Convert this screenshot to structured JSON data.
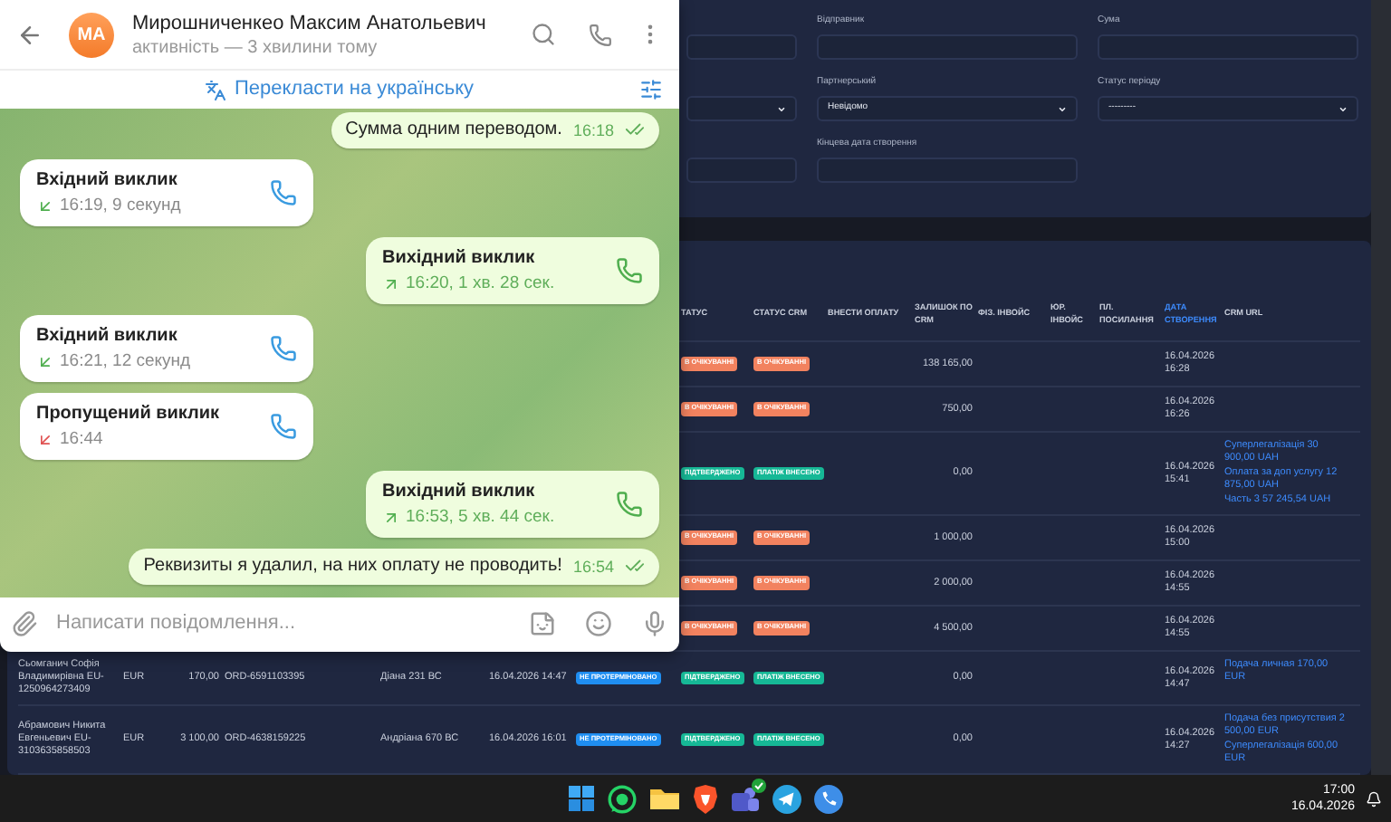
{
  "chat": {
    "header": {
      "avatar_initials": "MA",
      "name": "Мирошниченкео Максим Анатольевич",
      "status": "активність — 3 хвилини тому"
    },
    "translate_bar": {
      "label": "Перекласти на українську"
    },
    "messages": [
      {
        "kind": "text",
        "outgoing": true,
        "text": "Сумма одним переводом.",
        "time": "16:18",
        "read": true
      },
      {
        "kind": "call",
        "outgoing": false,
        "missed": false,
        "title": "Вхідний виклик",
        "detail": "16:19, 9 секунд"
      },
      {
        "kind": "call",
        "outgoing": true,
        "missed": false,
        "title": "Вихідний виклик",
        "detail": "16:20, 1 хв. 28 сек."
      },
      {
        "kind": "call",
        "outgoing": false,
        "missed": false,
        "title": "Вхідний виклик",
        "detail": "16:21, 12 секунд"
      },
      {
        "kind": "call",
        "outgoing": false,
        "missed": true,
        "title": "Пропущений виклик",
        "detail": "16:44"
      },
      {
        "kind": "call",
        "outgoing": true,
        "missed": false,
        "title": "Вихідний виклик",
        "detail": "16:53, 5 хв. 44 сек."
      },
      {
        "kind": "text",
        "outgoing": true,
        "text": "Реквизиты я удалил, на них оплату не проводить!",
        "time": "16:54",
        "read": true
      }
    ],
    "composer": {
      "placeholder": "Написати повідомлення..."
    }
  },
  "filters": {
    "fields": [
      {
        "kind": "input"
      },
      {
        "kind": "input",
        "label": "Відправник"
      },
      {
        "kind": "input",
        "label": "Сума"
      },
      {
        "kind": "select"
      },
      {
        "kind": "select",
        "label": "Партнерський",
        "value": "Невідомо"
      },
      {
        "kind": "select",
        "label": "Статус періоду",
        "value": "---------"
      },
      {
        "kind": "input"
      },
      {
        "kind": "input",
        "label": "Кінцева дата створення"
      }
    ]
  },
  "table": {
    "columns": [
      {
        "label": "ТАТУС",
        "sorted": false
      },
      {
        "label": "СТАТУС CRM",
        "sorted": false
      },
      {
        "label": "ВНЕСТИ ОПЛАТУ",
        "sorted": false
      },
      {
        "label": "ЗАЛИШОК ПО CRM",
        "sorted": false
      },
      {
        "label": "ФІЗ. ІНВОЙС",
        "sorted": false
      },
      {
        "label": "ЮР. ІНВОЙС",
        "sorted": false
      },
      {
        "label": "ПЛ. ПОСИЛАННЯ",
        "sorted": false
      },
      {
        "label": "ДАТА СТВОРЕННЯ",
        "sorted": true
      },
      {
        "label": "CRM URL",
        "sorted": false
      }
    ],
    "rows": [
      {
        "status": {
          "text": "В ОЧІКУВАННІ",
          "color": "#f2825f"
        },
        "crm_status": {
          "text": "В ОЧІКУВАННІ",
          "color": "#f2825f"
        },
        "balance": "138 165,00",
        "created": "16.04.2026 16:28"
      },
      {
        "status": {
          "text": "В ОЧІКУВАННІ",
          "color": "#f2825f"
        },
        "crm_status": {
          "text": "В ОЧІКУВАННІ",
          "color": "#f2825f"
        },
        "balance": "750,00",
        "created": "16.04.2026 16:26"
      },
      {
        "status": {
          "text": "ПІДТВЕРДЖЕНО",
          "color": "#16b896"
        },
        "crm_status": {
          "text": "ПЛАТІЖ ВНЕСЕНО",
          "color": "#16b896"
        },
        "balance": "0,00",
        "created": "16.04.2026 15:41",
        "crm_links": [
          "Суперлегалізація 30 900,00 UAH",
          "Оплата за доп услугу 12 875,00 UAH",
          "Часть 3 57 245,54 UAH"
        ]
      },
      {
        "status": {
          "text": "В ОЧІКУВАННІ",
          "color": "#f2825f"
        },
        "crm_status": {
          "text": "В ОЧІКУВАННІ",
          "color": "#f2825f"
        },
        "balance": "1 000,00",
        "created": "16.04.2026 15:00"
      },
      {
        "status": {
          "text": "В ОЧІКУВАННІ",
          "color": "#f2825f"
        },
        "crm_status": {
          "text": "В ОЧІКУВАННІ",
          "color": "#f2825f"
        },
        "balance": "2 000,00",
        "created": "16.04.2026 14:55"
      },
      {
        "status": {
          "text": "В ОЧІКУВАННІ",
          "color": "#f2825f"
        },
        "crm_status": {
          "text": "В ОЧІКУВАННІ",
          "color": "#f2825f"
        },
        "balance": "4 500,00",
        "created": "16.04.2026 14:55"
      },
      {
        "client": "Сьомганич Софія Владимирівна EU-1250964273409",
        "currency": "EUR",
        "amount": "170,00",
        "order": "ORD-6591103395",
        "manager": "Діана 231 ВС",
        "date": "16.04.2026 14:47",
        "deadline_status": {
          "text": "НЕ ПРОТЕРМІНОВАНО",
          "color": "#1f8ef1"
        },
        "status": {
          "text": "ПІДТВЕРДЖЕНО",
          "color": "#16b896"
        },
        "crm_status": {
          "text": "ПЛАТІЖ ВНЕСЕНО",
          "color": "#16b896"
        },
        "balance": "0,00",
        "created": "16.04.2026 14:47",
        "crm_links": [
          "Подача личная 170,00 EUR"
        ]
      },
      {
        "client": "Абрамович Никита Евгеньевич EU-3103635858503",
        "currency": "EUR",
        "amount": "3 100,00",
        "order": "ORD-4638159225",
        "manager": "Андріана 670 ВС",
        "date": "16.04.2026 16:01",
        "deadline_status": {
          "text": "НЕ ПРОТЕРМІНОВАНО",
          "color": "#1f8ef1"
        },
        "status": {
          "text": "ПІДТВЕРДЖЕНО",
          "color": "#16b896"
        },
        "crm_status": {
          "text": "ПЛАТІЖ ВНЕСЕНО",
          "color": "#16b896"
        },
        "balance": "0,00",
        "created": "16.04.2026 14:27",
        "crm_links": [
          "Подача без присутствия 2 500,00 EUR",
          "Суперлегалізація 600,00 EUR"
        ]
      }
    ]
  },
  "taskbar": {
    "time": "17:00",
    "date": "16.04.2026"
  }
}
